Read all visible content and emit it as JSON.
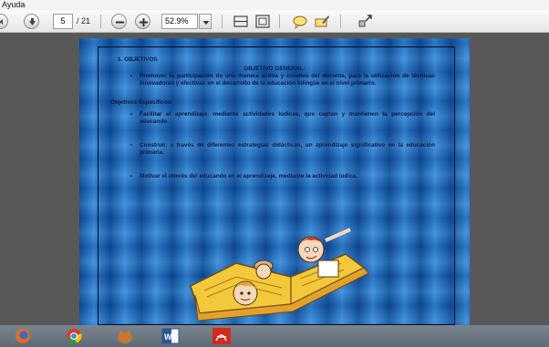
{
  "menubar": {
    "help_label": "Ayuda"
  },
  "toolbar": {
    "page_current": "5",
    "page_total": "/ 21",
    "zoom": "52.9%"
  },
  "document": {
    "section_title": "1. OBJETIVOS",
    "general_heading": "OBJETIVO GENERAL:",
    "general_text": "Promover la participación de una manera activa y creativa  del docente, para la utilización de técnicas innovadoras y efectivas en el desarrollo de la educación bilingüe en el nivel primario.",
    "specific_heading": "Objetivos Específicos:",
    "specific_items": [
      "Facilitar el aprendizaje, mediante actividades lúdicas, que captan y mantienen la percepción del educando.",
      "Construir, a través de diferentes estrategias didácticas, un aprendizaje significativo en la educación primaria.",
      "Motivar el interés del educando en el aprendizaje, mediante la actividad lúdica."
    ]
  },
  "taskbar": {
    "apps": [
      "firefox-icon",
      "chrome-icon",
      "gimp-icon",
      "word-icon",
      "pdf-reader-icon"
    ]
  }
}
